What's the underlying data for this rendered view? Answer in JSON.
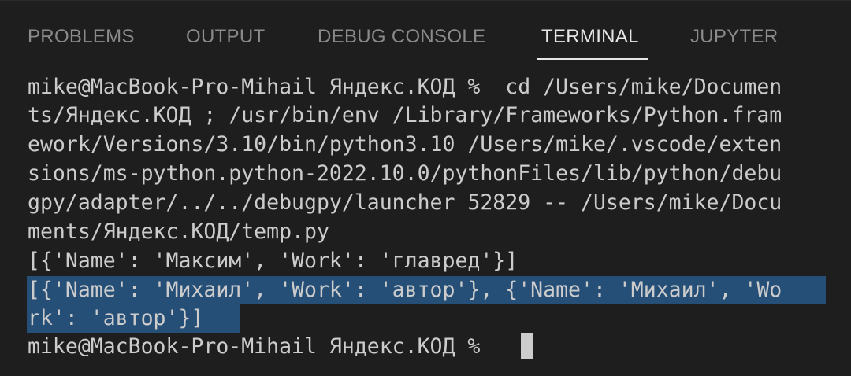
{
  "panel": {
    "tabs": [
      {
        "label": "PROBLEMS",
        "active": false
      },
      {
        "label": "OUTPUT",
        "active": false
      },
      {
        "label": "DEBUG CONSOLE",
        "active": false
      },
      {
        "label": "TERMINAL",
        "active": true
      },
      {
        "label": "JUPYTER",
        "active": false
      }
    ]
  },
  "terminal": {
    "lines": [
      "mike@MacBook-Pro-Mihail Яндекс.КОД %  cd /Users/mike/Documen",
      "ts/Яндекс.КОД ; /usr/bin/env /Library/Frameworks/Python.fram",
      "ework/Versions/3.10/bin/python3.10 /Users/mike/.vscode/exten",
      "sions/ms-python.python-2022.10.0/pythonFiles/lib/python/debu",
      "gpy/adapter/../../debugpy/launcher 52829 -- /Users/mike/Docu",
      "ments/Яндекс.КОД/temp.py",
      "[{'Name': 'Максим', 'Work': 'главред'}]",
      "[{'Name': 'Михаил', 'Work': 'автор'}, {'Name': 'Михаил', 'Wo",
      "rk': 'автор'}]",
      "mike@MacBook-Pro-Mihail Яндекс.КОД % "
    ]
  },
  "colors": {
    "background": "#1e1e1e",
    "text": "#cccccc",
    "tab_inactive": "#8b8b8b",
    "tab_active": "#e7e7e7",
    "selection": "#264f78"
  }
}
